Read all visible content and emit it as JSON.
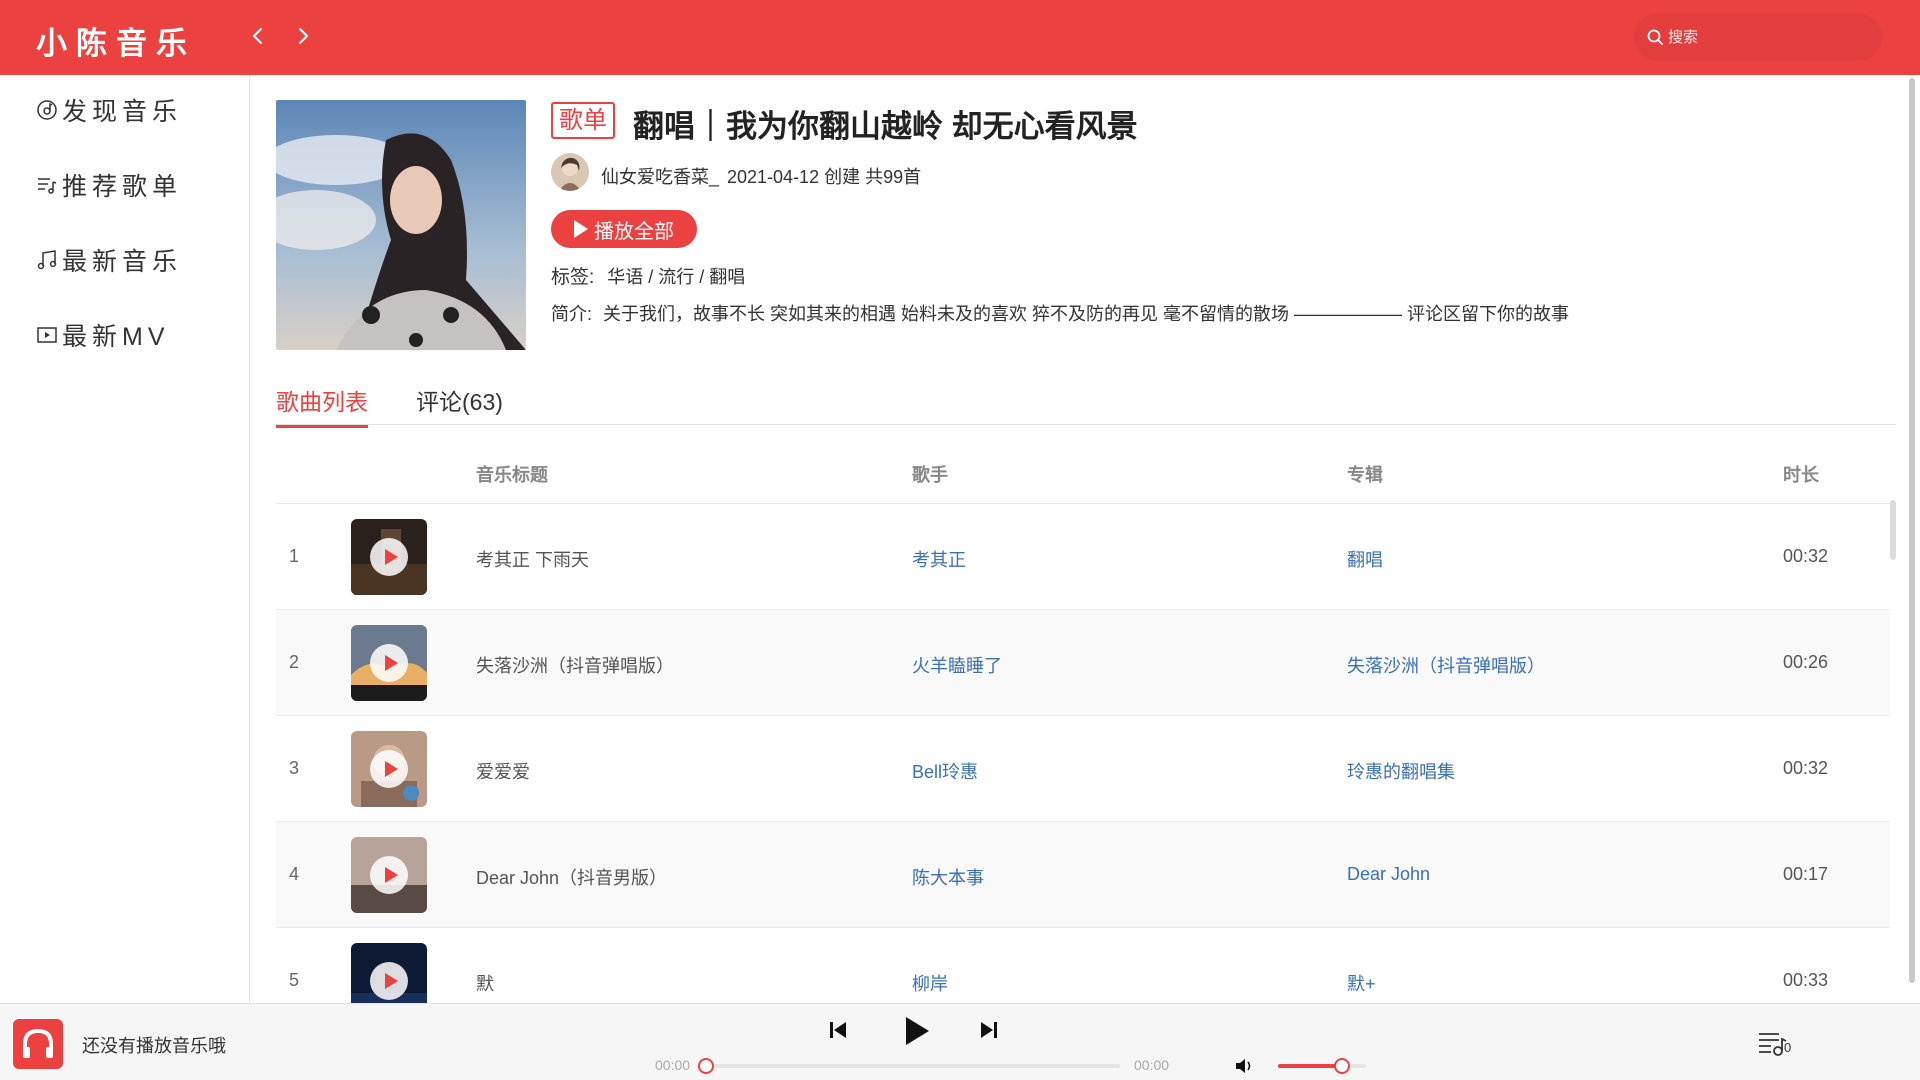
{
  "app": {
    "logo": "小陈音乐"
  },
  "header": {
    "search_placeholder": "搜索"
  },
  "sidebar": {
    "items": [
      {
        "label": "发现音乐",
        "icon": "disc-icon"
      },
      {
        "label": "推荐歌单",
        "icon": "playlist-icon"
      },
      {
        "label": "最新音乐",
        "icon": "music-note-icon"
      },
      {
        "label": "最新MV",
        "icon": "video-icon"
      }
    ]
  },
  "playlist": {
    "tag": "歌单",
    "title": "翻唱｜我为你翻山越岭 却无心看风景",
    "creator": "仙女爱吃香菜_",
    "created": "2021-04-12 创建 共99首",
    "play_all": "播放全部",
    "tags_label": "标签:",
    "tags": "华语 / 流行 / 翻唱",
    "intro_label": "简介:",
    "intro": "关于我们，故事不长 突如其来的相遇 始料未及的喜欢 猝不及防的再见 毫不留情的散场 ——————  评论区留下你的故事"
  },
  "tabs": [
    {
      "label": "歌曲列表",
      "active": true
    },
    {
      "label": "评论(63)",
      "active": false
    }
  ],
  "table": {
    "headers": {
      "title": "音乐标题",
      "singer": "歌手",
      "album": "专辑",
      "duration": "时长"
    },
    "rows": [
      {
        "index": "1",
        "title": "考其正 下雨天",
        "singer": "考其正",
        "album": "翻唱",
        "duration": "00:32"
      },
      {
        "index": "2",
        "title": "失落沙洲（抖音弹唱版）",
        "singer": "火羊瞌睡了",
        "album": "失落沙洲（抖音弹唱版）",
        "duration": "00:26"
      },
      {
        "index": "3",
        "title": "爱爱爱",
        "singer": "Bell玲惠",
        "album": "玲惠的翻唱集",
        "duration": "00:32"
      },
      {
        "index": "4",
        "title": "Dear John（抖音男版）",
        "singer": "陈大本事",
        "album": "Dear John",
        "duration": "00:17"
      },
      {
        "index": "5",
        "title": "默",
        "singer": "柳岸",
        "album": "默+",
        "duration": "00:33"
      }
    ]
  },
  "player": {
    "status": "还没有播放音乐哦",
    "current_time": "00:00",
    "total_time": "00:00",
    "progress": 0,
    "volume": 0.72,
    "playlist_count": "0"
  },
  "colors": {
    "accent": "#ec4141",
    "link": "#3a70b4"
  }
}
